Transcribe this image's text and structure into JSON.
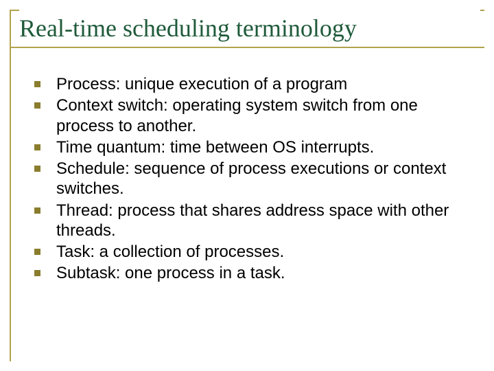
{
  "title": "Real-time scheduling terminology",
  "bullets": {
    "b0": "Process: unique execution of a program",
    "b1": "Context switch: operating system switch from one process to another.",
    "b2": "Time quantum: time between OS interrupts.",
    "b3": "Schedule: sequence of process executions or context switches.",
    "b4": "Thread: process that shares address space with other threads.",
    "b5": "Task: a collection of processes.",
    "b6": "Subtask: one process in a task."
  }
}
